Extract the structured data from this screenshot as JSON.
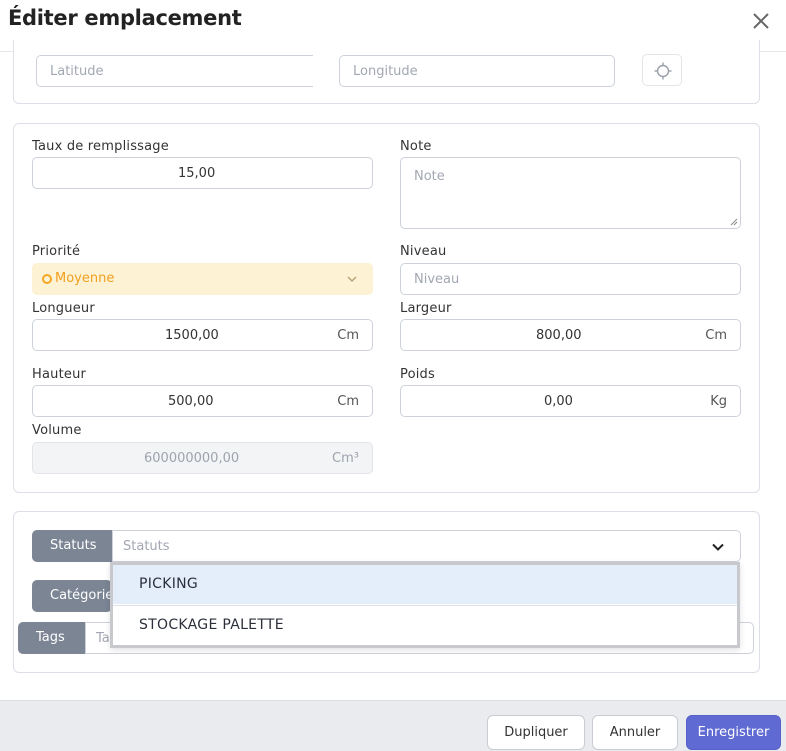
{
  "dialog": {
    "title": "Éditer emplacement"
  },
  "geo": {
    "latitude_placeholder": "Latitude",
    "longitude_placeholder": "Longitude"
  },
  "details": {
    "fill_rate": {
      "label": "Taux de remplissage",
      "value": "15,00"
    },
    "note": {
      "label": "Note",
      "placeholder": "Note"
    },
    "priority": {
      "label": "Priorité",
      "value": "Moyenne"
    },
    "level": {
      "label": "Niveau",
      "placeholder": "Niveau"
    },
    "length": {
      "label": "Longueur",
      "value": "1500,00",
      "unit": "Cm"
    },
    "width": {
      "label": "Largeur",
      "value": "800,00",
      "unit": "Cm"
    },
    "height": {
      "label": "Hauteur",
      "value": "500,00",
      "unit": "Cm"
    },
    "weight": {
      "label": "Poids",
      "value": "0,00",
      "unit": "Kg"
    },
    "volume": {
      "label": "Volume",
      "value": "600000000,00",
      "unit": "Cm³"
    }
  },
  "classification": {
    "statuts": {
      "button": "Statuts",
      "placeholder": "Statuts"
    },
    "categories": {
      "button": "Catégorie"
    },
    "tags": {
      "button": "Tags",
      "placeholder": "Ta"
    },
    "dropdown_options": [
      "PICKING",
      "STOCKAGE PALETTE"
    ]
  },
  "footer": {
    "duplicate": "Dupliquer",
    "cancel": "Annuler",
    "save": "Enregistrer"
  },
  "colors": {
    "priority_bg": "#fdf2d3",
    "priority_text": "#f0a020",
    "primary": "#5f6ad3",
    "tag_button": "#7b8594"
  }
}
